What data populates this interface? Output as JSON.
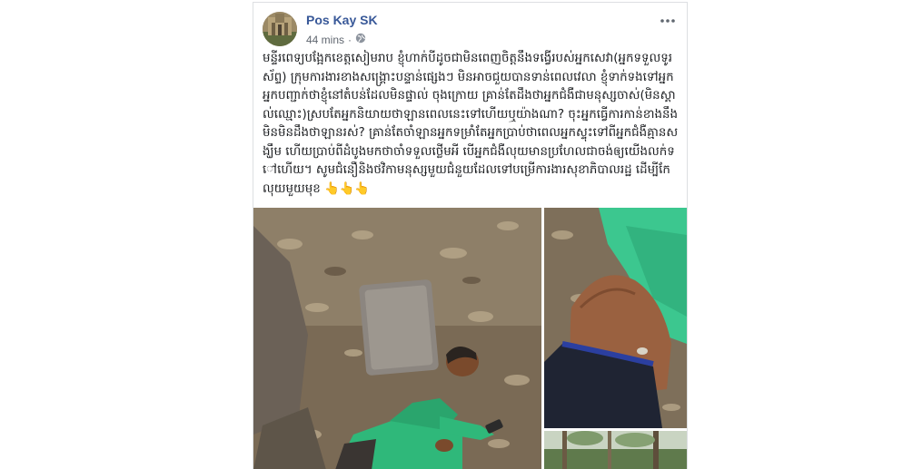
{
  "post": {
    "author": "Pos Kay SK",
    "timestamp": "44 mins",
    "audience_icon": "globe-icon",
    "more_icon": "more-options-icon",
    "text": "មន្ទីរពេទ្យបង្អែកខេត្តសៀមរាប ខ្ញុំហាក់បីដូចជាមិនពេញចិត្តនឹងទង្វើរបស់អ្នកសេវា(អ្នកទទួលទូរស័ព្ទ) ក្រុមការងារខាងសង្គ្រោះបន្ទាន់ផ្សេងៗ មិនអាចជួយបានទាន់ពេលវេលា ខ្ញុំទាក់ទងទៅអ្នក អ្នកបញ្ជាក់ថាខ្ញុំនៅតំបន់ដែលមិនផ្ទាល់ ចុងក្រោយ គ្រាន់តែដឹងថាអ្នកជំងឺជាមនុស្សចាស់(មិនស្គាល់ឈ្មោះ)ស្របតែអ្នកនិយាយថាឡានពេលនេះទៅហើយឬយ៉ាងណា? ចុះអ្នកធ្វើការកាន់ខាងនឹង មិនមិនដឹងថាឡានរស់? គ្រាន់តែចាំឡានអ្នកទម្រាំតែអ្នកប្រាប់ថាពេលអ្នកស្ទុះទៅពីអ្នកជំងឺគ្មានសង្ឃឹម ហើយប្រាប់ពីដំបូងមកថាចាំទទួលថ្លើមអី បើអ្នកជំងឺលុយមានប្រហែលជាចង់ឲ្យយើងលក់ទៅហើយ។ សូមជំនឿនិងថវិកាមនុស្សមួយជំនួយដែលទៅបម្រើការងារសុខាភិបាលរដ្ឋ ដើម្បីកែលុយមួយមុខ",
    "emojis": "👆👆👆"
  },
  "photos": [
    {
      "name": "photo-man-lying-on-leaves"
    },
    {
      "name": "photo-wound-on-abdomen"
    },
    {
      "name": "photo-forest-trees"
    }
  ],
  "colors": {
    "author_blue": "#385898",
    "meta_gray": "#606770",
    "text": "#1c1e21",
    "shirt_green": "#2fb87a"
  }
}
